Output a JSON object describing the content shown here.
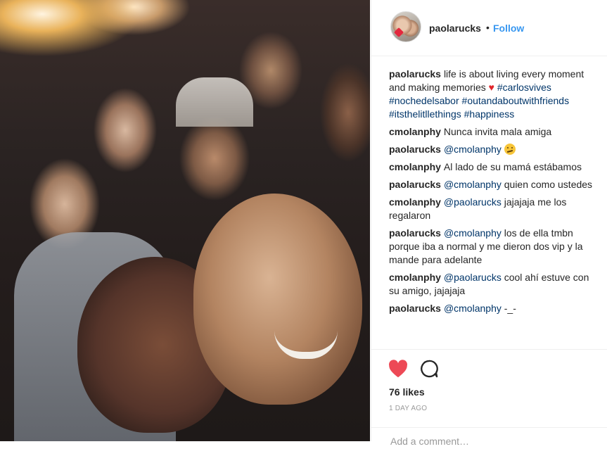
{
  "header": {
    "username": "paolarucks",
    "separator": "•",
    "follow_label": "Follow"
  },
  "caption": {
    "username": "paolarucks",
    "text": "life is about living every moment and making memories",
    "heart": "♥",
    "hashtags": [
      "#carlosvives",
      "#nochedelsabor",
      "#outandaboutwithfriends",
      "#itsthelitllethings",
      "#happiness"
    ]
  },
  "comments": [
    {
      "user": "cmolanphy",
      "mention": "",
      "text": "Nunca invita mala amiga"
    },
    {
      "user": "paolarucks",
      "mention": "@cmolanphy",
      "text": ""
    },
    {
      "user": "cmolanphy",
      "mention": "",
      "text": "Al lado de su mamá estábamos"
    },
    {
      "user": "paolarucks",
      "mention": "@cmolanphy",
      "text": "quien como ustedes"
    },
    {
      "user": "cmolanphy",
      "mention": "@paolarucks",
      "text": "jajajaja me los regalaron"
    },
    {
      "user": "paolarucks",
      "mention": "@cmolanphy",
      "text": "los de ella tmbn porque iba a normal y me dieron dos vip y la mande para adelante"
    },
    {
      "user": "cmolanphy",
      "mention": "@paolarucks",
      "text": "cool ahí estuve con su amigo, jajajaja"
    },
    {
      "user": "paolarucks",
      "mention": "@cmolanphy",
      "text": "-_-"
    }
  ],
  "actions": {
    "like_icon": "heart-filled-icon",
    "comment_icon": "speech-bubble-icon",
    "likes": "76 likes",
    "timestamp": "1 DAY AGO"
  },
  "add_comment": {
    "placeholder": "Add a comment…"
  },
  "colors": {
    "link": "#3897f0",
    "hashtag": "#003569",
    "like": "#ed4956"
  }
}
